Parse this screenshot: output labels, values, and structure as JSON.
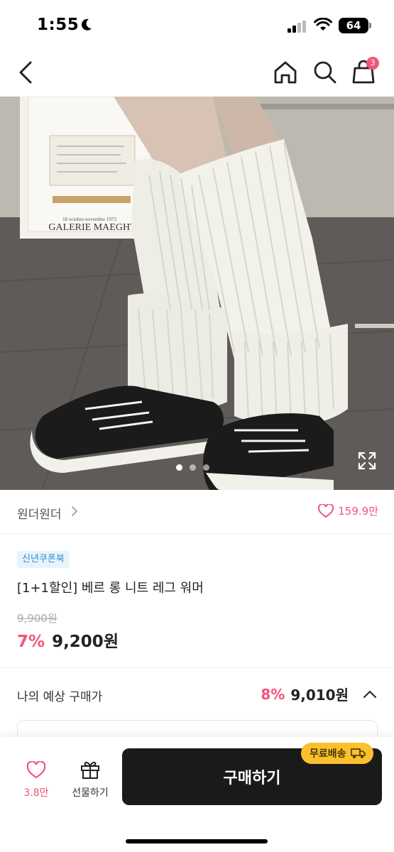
{
  "status_bar": {
    "time": "1:55",
    "battery": "64"
  },
  "header": {
    "cart_count": "3"
  },
  "gallery": {
    "poster_caption": "GALERIE MAEGHT",
    "poster_subcaption": "18 octobre-novembre 1973",
    "total_images": 3,
    "active_index": 0
  },
  "seller": {
    "name": "원더원더",
    "likes": "159.9만"
  },
  "product": {
    "coupon_tag": "신년쿠폰북",
    "title": "[1+1할인] 베르 롱 니트 레그 워머",
    "original_price": "9,900원",
    "discount": "7%",
    "price": "9,200원"
  },
  "expected_price": {
    "label": "나의 예상 구매가",
    "discount": "8%",
    "price": "9,010원"
  },
  "bottom_bar": {
    "fav_count": "3.8만",
    "gift_label": "선물하기",
    "buy_label": "구매하기",
    "free_shipping_label": "무료배송"
  },
  "colors": {
    "accent": "#f0557a",
    "coupon_text": "#2e8fd1",
    "coupon_bg": "#e8f4fb",
    "buy_button": "#1a1a1a",
    "free_shipping": "#fbc02d"
  }
}
